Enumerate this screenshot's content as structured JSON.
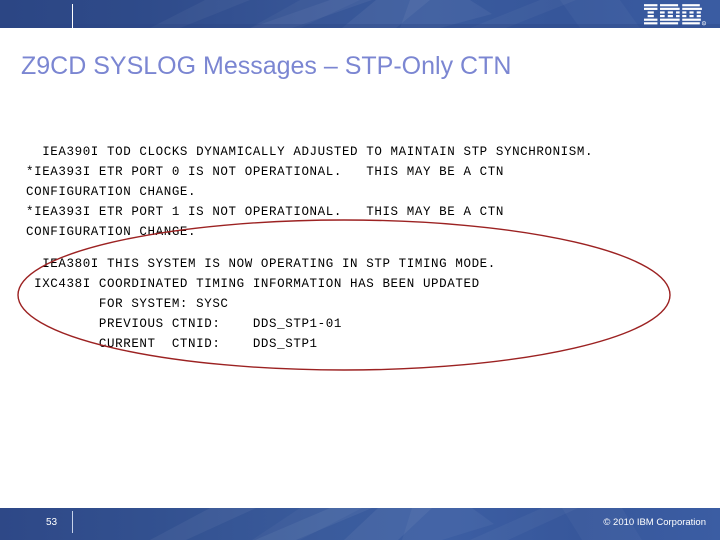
{
  "header": {
    "logo_name": "ibm-logo",
    "band_color_left": "#2c4684",
    "band_color_right": "#3a5ca2"
  },
  "title": {
    "text": "Z9CD SYSLOG Messages – STP-Only CTN",
    "color": "#7b86d2"
  },
  "body": {
    "block_one": "  IEA390I TOD CLOCKS DYNAMICALLY ADJUSTED TO MAINTAIN STP SYNCHRONISM.\n*IEA393I ETR PORT 0 IS NOT OPERATIONAL.   THIS MAY BE A CTN\nCONFIGURATION CHANGE.\n*IEA393I ETR PORT 1 IS NOT OPERATIONAL.   THIS MAY BE A CTN\nCONFIGURATION CHANGE.",
    "block_two": "  IEA380I THIS SYSTEM IS NOW OPERATING IN STP TIMING MODE.\n IXC438I COORDINATED TIMING INFORMATION HAS BEEN UPDATED\n         FOR SYSTEM: SYSC\n         PREVIOUS CTNID:    DDS_STP1-01\n         CURRENT  CTNID:    DDS_STP1"
  },
  "annotation": {
    "shape": "ellipse",
    "color": "#9c2222",
    "stroke_width": 1.4
  },
  "footer": {
    "page_number": "53",
    "copyright": "© 2010 IBM Corporation"
  }
}
